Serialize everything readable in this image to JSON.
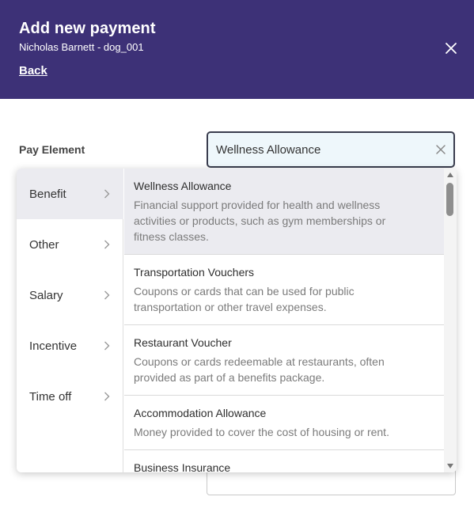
{
  "header": {
    "title": "Add new payment",
    "subtitle": "Nicholas Barnett - dog_001",
    "back_label": "Back",
    "close_icon": "close-icon",
    "background_color": "#3d3177"
  },
  "form": {
    "pay_element_label": "Pay Element",
    "pay_element_value": "Wellness Allowance",
    "clear_icon": "clear-icon"
  },
  "dropdown": {
    "categories": [
      {
        "label": "Benefit",
        "active": true
      },
      {
        "label": "Other",
        "active": false
      },
      {
        "label": "Salary",
        "active": false
      },
      {
        "label": "Incentive",
        "active": false
      },
      {
        "label": "Time off",
        "active": false
      }
    ],
    "options": [
      {
        "name": "Wellness Allowance",
        "desc_lines": [
          "Financial support provided for health and wellness",
          "activities or products, such as gym memberships or",
          "fitness classes."
        ],
        "active": true
      },
      {
        "name": "Transportation Vouchers",
        "desc_lines": [
          "Coupons or cards that can be used for public",
          "transportation or other travel expenses."
        ],
        "active": false
      },
      {
        "name": "Restaurant Voucher",
        "desc_lines": [
          "Coupons or cards redeemable at restaurants, often",
          "provided as part of a benefits package."
        ],
        "active": false
      },
      {
        "name": "Accommodation Allowance",
        "desc_lines": [
          "Money provided to cover the cost of housing or rent."
        ],
        "active": false
      },
      {
        "name": "Business Insurance",
        "desc_lines": [],
        "active": false
      }
    ],
    "active_background": "#ebebf0"
  }
}
